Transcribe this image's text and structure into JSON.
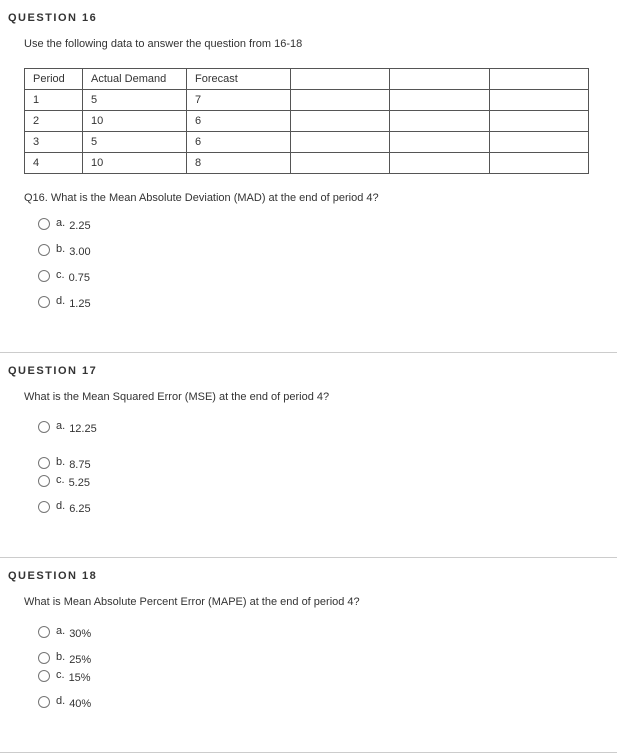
{
  "q16": {
    "title": "QUESTION 16",
    "instruction": "Use the following data to answer the question from 16-18",
    "table": {
      "headers": [
        "Period",
        "Actual Demand",
        "Forecast"
      ],
      "rows": [
        [
          "1",
          "5",
          "7"
        ],
        [
          "2",
          "10",
          "6"
        ],
        [
          "3",
          "5",
          "6"
        ],
        [
          "4",
          "10",
          "8"
        ]
      ]
    },
    "subq": "Q16. What is the Mean Absolute Deviation (MAD) at the end of period 4?",
    "options": [
      {
        "key": "a.",
        "val": "2.25"
      },
      {
        "key": "b.",
        "val": "3.00"
      },
      {
        "key": "c.",
        "val": "0.75"
      },
      {
        "key": "d.",
        "val": "1.25"
      }
    ]
  },
  "q17": {
    "title": "QUESTION 17",
    "subq": "What is the Mean Squared Error (MSE) at the end of period 4?",
    "options": [
      {
        "key": "a.",
        "val": "12.25"
      },
      {
        "key": "b.",
        "val": "8.75"
      },
      {
        "key": "c.",
        "val": "5.25"
      },
      {
        "key": "d.",
        "val": "6.25"
      }
    ]
  },
  "q18": {
    "title": "QUESTION 18",
    "subq": "What is Mean Absolute Percent Error (MAPE) at the end of period 4?",
    "options": [
      {
        "key": "a.",
        "val": "30%"
      },
      {
        "key": "b.",
        "val": "25%"
      },
      {
        "key": "c.",
        "val": "15%"
      },
      {
        "key": "d.",
        "val": "40%"
      }
    ]
  },
  "chart_data": {
    "type": "table",
    "columns": [
      "Period",
      "Actual Demand",
      "Forecast"
    ],
    "rows": [
      [
        1,
        5,
        7
      ],
      [
        2,
        10,
        6
      ],
      [
        3,
        5,
        6
      ],
      [
        4,
        10,
        8
      ]
    ]
  }
}
